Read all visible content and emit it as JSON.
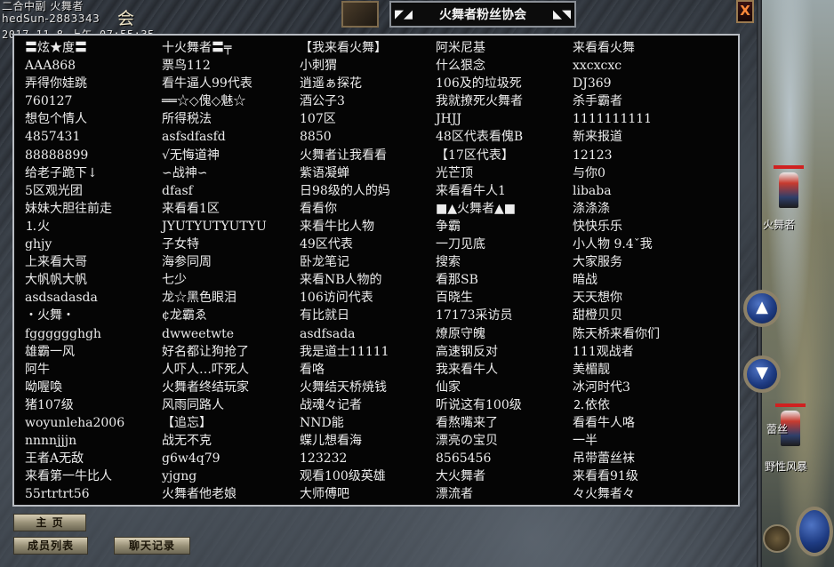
{
  "header": {
    "line1": "二合中副 火舞者",
    "line2": "hedSun-2883343",
    "line2_suffix": "会",
    "line3": "2017-11-8 上午 07:55:35"
  },
  "title_box": {
    "left_icon": "◤◢",
    "title": "火舞者粉丝协会",
    "right_icon": "◣◥"
  },
  "close_label": "X",
  "columns": [
    [
      "〓炫★度〓",
      "AAA868",
      "弄得你娃跳",
      "760127",
      "想包个情人",
      "4857431",
      "88888899",
      "给老子跪下↓",
      "5区观光团",
      "妹妹大胆往前走",
      "⒈火",
      "ghjy",
      "上来看大哥",
      "大帆帆大帆",
      "asdsadasda",
      "・火舞・",
      "fgggggghgh",
      "雄霸一风",
      "阿牛",
      "呦喔喚",
      "猪107级",
      "woyunleha2006",
      "nnnnjjjn",
      "王者A无敌",
      "来看第一牛比人",
      "55rtrtrt56"
    ],
    [
      "十火舞者〓╤",
      "票鸟112",
      "看牛逼人99代表",
      "══☆◇傀◇魅☆",
      "所得税法",
      "asfsdfasfd",
      "√无悔道神",
      "∽战神∽",
      "dfasf",
      "来看看1区",
      "JYUTYUTYUTYU",
      "子女特",
      "海参同周",
      "七少",
      "龙☆黑色眼泪",
      "¢龙霸ゑ",
      "dwweetwte",
      "好名都让狗抢了",
      "人吓人…吓死人",
      "火舞者终结玩家",
      "风雨同路人",
      "【追忘】",
      "战无不克",
      "g6w4q79",
      "yjgng",
      "火舞者他老娘"
    ],
    [
      "【我来看火舞】",
      "小刺猬",
      "逍遥ぁ探花",
      "酒公子3",
      "107区",
      "8850",
      "火舞者让我看看",
      "紫语凝蝉",
      "日98级的人的妈",
      "看看你",
      "来看牛比人物",
      "49区代表",
      "卧龙笔记",
      "来看NB人物的",
      "106访问代表",
      "有比就日",
      "asdfsada",
      "我是道士11111",
      "看咯",
      "火舞结天桥焼钱",
      "战魂々记者",
      "NND能",
      "蝶儿想看海",
      "123232",
      "观看100级英雄",
      "大师傅吧"
    ],
    [
      "阿米尼基",
      "什么狠念",
      "106及的垃圾死",
      "我就撩死火舞者",
      "JHJJ",
      "48区代表看傀B",
      "【17区代表】",
      "光芒顶",
      "来看看牛人1",
      "■▲火舞者▲■",
      "争霸",
      "一刀见底",
      "搜索",
      "看那SB",
      "百晓生",
      "17173采访员",
      "燎原守魄",
      "高速钢反对",
      "我来看牛人",
      "仙家",
      "听说这有100级",
      "看熬嘴来了",
      "漂亮の宝贝",
      "8565456",
      "大火舞者",
      "漂流者"
    ],
    [
      "来看看火舞",
      "xxcxcxc",
      "DJ369",
      "杀手霸者",
      "1111111111",
      "新来报道",
      "12123",
      "与你0",
      "libaba",
      "涤涤涤",
      "快快乐乐",
      "小人物 9.4ˇ我",
      "大家服务",
      "暗战",
      "天天想你",
      "甜橙贝贝",
      "陈天桥来看你们",
      "111观战者",
      "美楣靓",
      "冰河时代3",
      "⒉依依",
      "看看牛人咯",
      "一半",
      "吊带蕾丝袜",
      "来看看91级",
      "々火舞者々"
    ]
  ],
  "buttons": {
    "home": "主 页",
    "members": "成员列表",
    "chat": "聊天记录"
  },
  "scene": {
    "name1": "火舞者",
    "name2": "蕾丝",
    "name3": "野性风暴"
  },
  "colors": {
    "panel_bg": "#050505",
    "text": "#ececec",
    "hp_bar": "#d02020",
    "round_button": "#1e3b82"
  }
}
